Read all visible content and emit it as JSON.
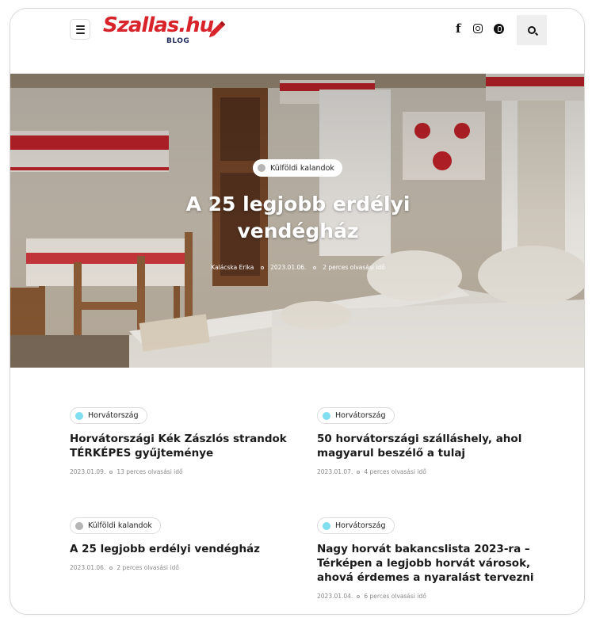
{
  "header": {
    "logo_text": "Szallas.hu",
    "logo_sub": "BLOG",
    "social": [
      "facebook-icon",
      "instagram-icon",
      "pinterest-icon"
    ],
    "facebook_glyph": "f",
    "brand_color": "#d8232a"
  },
  "hero": {
    "category": "Külföldi kalandok",
    "category_dot_color": "#b5b5b5",
    "title": "A 25 legjobb erdélyi vendégház",
    "author": "Kalácska Erika",
    "date": "2023.01.06.",
    "read_time": "2 perces olvasási idő"
  },
  "posts": [
    {
      "category": "Horvátország",
      "dot_color": "#7fdff0",
      "title": "Horvátországi Kék Zászlós strandok TÉRKÉPES gyűjteménye",
      "date": "2023.01.09.",
      "read_time": "13 perces olvasási idő"
    },
    {
      "category": "Horvátország",
      "dot_color": "#7fdff0",
      "title": "50 horvátországi szálláshely, ahol magyarul beszélő a tulaj",
      "date": "2023.01.07.",
      "read_time": "4 perces olvasási idő"
    },
    {
      "category": "Külföldi kalandok",
      "dot_color": "#b5b5b5",
      "title": "A 25 legjobb erdélyi vendégház",
      "date": "2023.01.06.",
      "read_time": "2 perces olvasási idő"
    },
    {
      "category": "Horvátország",
      "dot_color": "#7fdff0",
      "title": "Nagy horvát bakancslista 2023-ra – Térképen a legjobb horvát városok, ahová érdemes a nyaralást tervezni",
      "date": "2023.01.04.",
      "read_time": "6 perces olvasási idő"
    }
  ]
}
